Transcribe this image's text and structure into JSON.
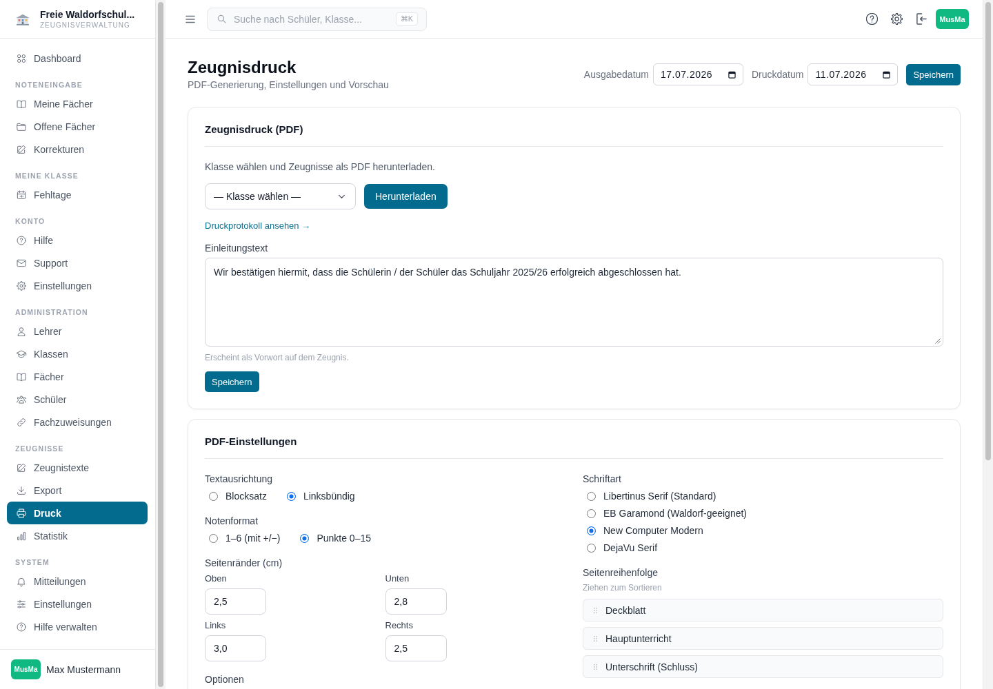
{
  "sidebar": {
    "brand": {
      "title": "Freie Waldorfschul...",
      "subtitle": "ZEUGNISVERWALTUNG"
    },
    "items": [
      {
        "label": "Dashboard",
        "selected": false
      }
    ],
    "sections": [
      {
        "heading": "NOTENEINGABE",
        "items": [
          {
            "label": "Meine Fächer",
            "selected": false
          },
          {
            "label": "Offene Fächer",
            "selected": false
          },
          {
            "label": "Korrekturen",
            "selected": false
          }
        ]
      },
      {
        "heading": "MEINE KLASSE",
        "items": [
          {
            "label": "Fehltage",
            "selected": false
          }
        ]
      },
      {
        "heading": "KONTO",
        "items": [
          {
            "label": "Hilfe",
            "selected": false
          },
          {
            "label": "Support",
            "selected": false
          },
          {
            "label": "Einstellungen",
            "selected": false
          }
        ]
      },
      {
        "heading": "ADMINISTRATION",
        "items": [
          {
            "label": "Lehrer",
            "selected": false
          },
          {
            "label": "Klassen",
            "selected": false
          },
          {
            "label": "Fächer",
            "selected": false
          },
          {
            "label": "Schüler",
            "selected": false
          },
          {
            "label": "Fachzuweisungen",
            "selected": false
          }
        ]
      },
      {
        "heading": "ZEUGNISSE",
        "items": [
          {
            "label": "Zeugnistexte",
            "selected": false
          },
          {
            "label": "Export",
            "selected": false
          },
          {
            "label": "Druck",
            "selected": true
          },
          {
            "label": "Statistik",
            "selected": false
          }
        ]
      },
      {
        "heading": "SYSTEM",
        "items": [
          {
            "label": "Mitteilungen",
            "selected": false
          },
          {
            "label": "Einstellungen",
            "selected": false
          },
          {
            "label": "Hilfe verwalten",
            "selected": false
          }
        ]
      }
    ],
    "user": {
      "initials": "MusMa",
      "name": "Max Mustermann"
    }
  },
  "topbar": {
    "search": {
      "placeholder": "Suche nach Schüler, Klasse...",
      "shortcut": "⌘K"
    },
    "avatar": "MusMa"
  },
  "page": {
    "title": "Zeugnisdruck",
    "subtitle": "PDF-Generierung, Einstellungen und Vorschau",
    "dates": [
      {
        "label": "Ausgabedatum",
        "value": "17.07.2026"
      },
      {
        "label": "Druckdatum",
        "value": "11.07.2026"
      }
    ],
    "save_button": "Speichern"
  },
  "print_card": {
    "title": "Zeugnisdruck (PDF)",
    "description": "Klasse wählen und Zeugnisse als PDF herunterladen.",
    "class_select": {
      "value": "— Klasse wählen —"
    },
    "download_button": "Herunterladen",
    "log_link": "Druckprotokoll ansehen →",
    "intro": {
      "label": "Einleitungstext",
      "value": "Wir bestätigen hiermit, dass die Schülerin / der Schüler das Schuljahr 2025/26 erfolgreich abgeschlossen hat.",
      "hint": "Erscheint als Vorwort auf dem Zeugnis."
    },
    "save_button": "Speichern"
  },
  "settings_card": {
    "title": "PDF-Einstellungen",
    "text_alignment": {
      "label": "Textausrichtung",
      "options": [
        {
          "label": "Blocksatz",
          "selected": false
        },
        {
          "label": "Linksbündig",
          "selected": true
        }
      ]
    },
    "grade_format": {
      "label": "Notenformat",
      "options": [
        {
          "label": "1–6 (mit +/−)",
          "selected": false
        },
        {
          "label": "Punkte 0–15",
          "selected": true
        }
      ]
    },
    "margins": {
      "label": "Seitenränder (cm)",
      "fields": [
        {
          "label": "Oben",
          "value": "2,5"
        },
        {
          "label": "Unten",
          "value": "2,8"
        },
        {
          "label": "Links",
          "value": "3,0"
        },
        {
          "label": "Rechts",
          "value": "2,5"
        }
      ]
    },
    "options_heading": "Optionen",
    "font": {
      "label": "Schriftart",
      "options": [
        {
          "label": "Libertinus Serif (Standard)",
          "selected": false
        },
        {
          "label": "EB Garamond (Waldorf-geeignet)",
          "selected": false
        },
        {
          "label": "New Computer Modern",
          "selected": true
        },
        {
          "label": "DejaVu Serif",
          "selected": false
        }
      ]
    },
    "page_order": {
      "label": "Seitenreihenfolge",
      "hint": "Ziehen zum Sortieren",
      "items": [
        "Deckblatt",
        "Hauptunterricht",
        "Unterschrift (Schluss)"
      ]
    }
  }
}
